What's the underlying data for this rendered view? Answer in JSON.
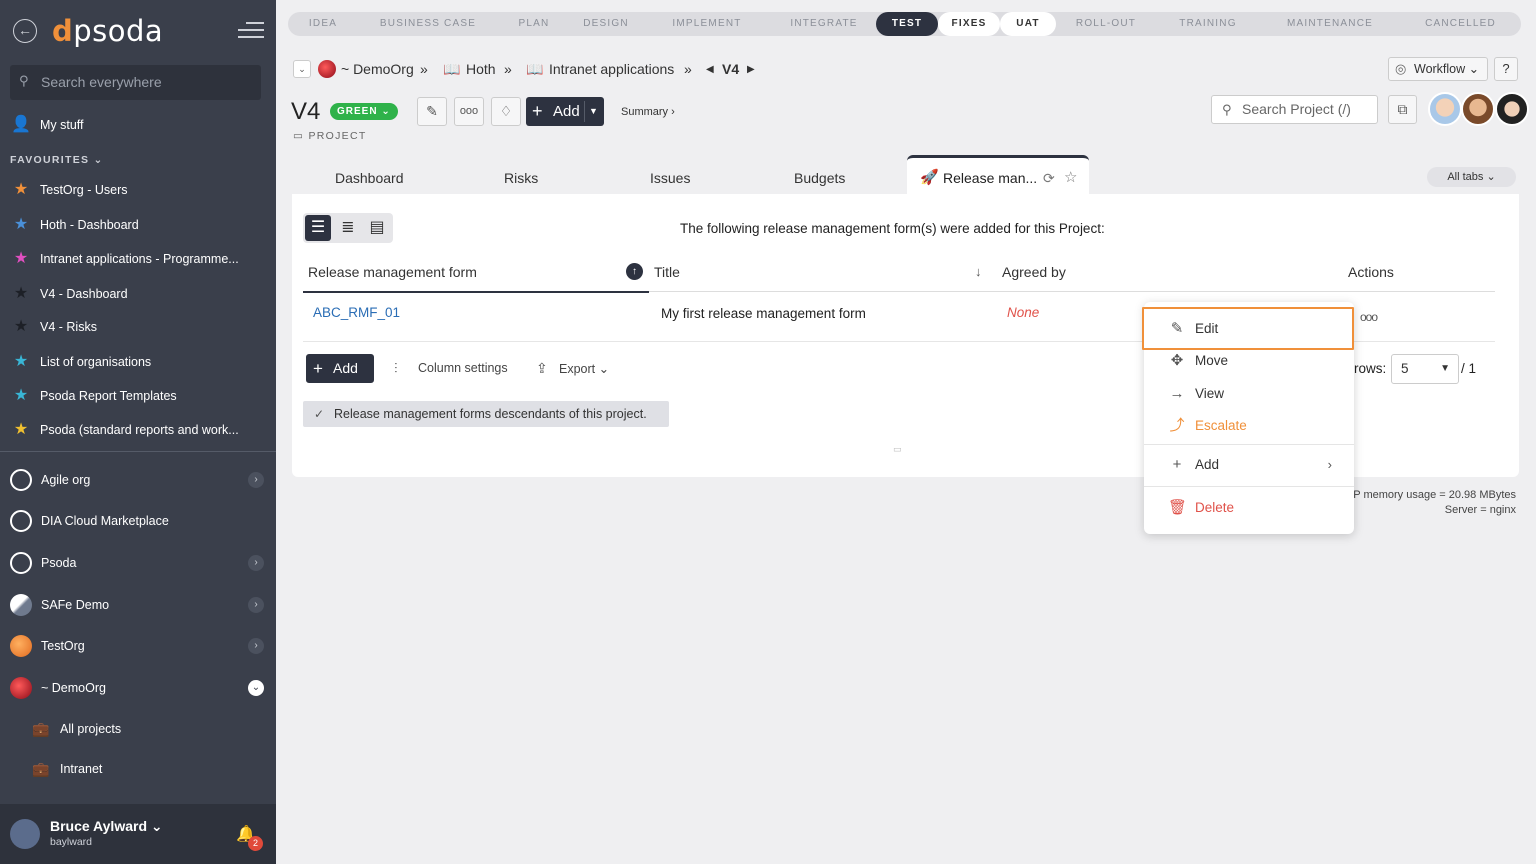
{
  "sidebar": {
    "logo": "psoda",
    "search_placeholder": "Search everywhere",
    "my_stuff": "My stuff",
    "favourites_label": "FAVOURITES",
    "favourites": [
      {
        "label": "TestOrg - Users",
        "star_color": "#f0903a"
      },
      {
        "label": "Hoth - Dashboard",
        "star_color": "#4a90d9"
      },
      {
        "label": "Intranet applications - Programme...",
        "star_color": "#e04fc0"
      },
      {
        "label": "V4 - Dashboard",
        "star_color": "#2a2d35"
      },
      {
        "label": "V4 - Risks",
        "star_color": "#2a2d35"
      },
      {
        "label": "List of organisations",
        "star_color": "#39b6d6"
      },
      {
        "label": "Psoda Report Templates",
        "star_color": "#39b6d6"
      },
      {
        "label": "Psoda (standard reports and work...",
        "star_color": "#f0c030"
      }
    ],
    "orgs": [
      {
        "label": "Agile org",
        "expandable": true
      },
      {
        "label": "DIA Cloud Marketplace",
        "expandable": false
      },
      {
        "label": "Psoda",
        "expandable": true
      },
      {
        "label": "SAFe Demo",
        "expandable": true
      },
      {
        "label": "TestOrg",
        "expandable": true
      },
      {
        "label": "~ DemoOrg",
        "expandable": true
      }
    ],
    "demoorg_children": [
      "All projects",
      "Intranet"
    ],
    "user": {
      "name": "Bruce Aylward",
      "username": "baylward",
      "notifications": "2"
    }
  },
  "stages": [
    "IDEA",
    "BUSINESS CASE",
    "PLAN",
    "DESIGN",
    "IMPLEMENT",
    "INTEGRATE",
    "TEST",
    "FIXES",
    "UAT",
    "ROLL-OUT",
    "TRAINING",
    "MAINTENANCE",
    "CANCELLED"
  ],
  "active_stage": "TEST",
  "breadcrumb": {
    "org": "~ DemoOrg",
    "sep": "»",
    "programme": "Hoth",
    "portfolio": "Intranet applications",
    "project": "V4"
  },
  "workflow_label": "Workflow",
  "help_label": "?",
  "project": {
    "title": "V4",
    "status": "GREEN",
    "type": "PROJECT"
  },
  "add_label": "Add",
  "summary_label": "Summary ›",
  "search_project_placeholder": "Search Project (/)",
  "tabs": [
    "Dashboard",
    "Risks",
    "Issues",
    "Budgets"
  ],
  "active_tab": "Release man...",
  "all_tabs_label": "All tabs",
  "intro_text": "The following release management form(s) were added for this Project:",
  "table": {
    "columns": [
      "Release management form",
      "Title",
      "Agreed by",
      "Actions"
    ],
    "rows": [
      {
        "form": "ABC_RMF_01",
        "title": "My first release management form",
        "agreed_by": "None"
      }
    ]
  },
  "table_add_label": "Add",
  "column_settings_label": "Column settings",
  "export_label": "Export",
  "rows_label": "rows:",
  "rows_value": "5",
  "pages_label": "/ 1",
  "notice_text": "Release management forms descendants of this project.",
  "footer": {
    "memory": "P memory usage = 20.98 MBytes",
    "server": "Server = nginx"
  },
  "context_menu": {
    "items": [
      {
        "label": "Edit",
        "icon": "pencil-icon"
      },
      {
        "label": "Move",
        "icon": "move-icon"
      },
      {
        "label": "View",
        "icon": "arrow-right-icon"
      },
      {
        "label": "Escalate",
        "icon": "escalate-icon"
      },
      {
        "label": "Add",
        "icon": "plus-icon"
      },
      {
        "label": "Delete",
        "icon": "trash-icon"
      }
    ]
  },
  "colors": {
    "accent": "#2d3240",
    "orange": "#f0903a",
    "green": "#2fb24a",
    "link": "#2a6db5",
    "red": "#e0524a"
  }
}
